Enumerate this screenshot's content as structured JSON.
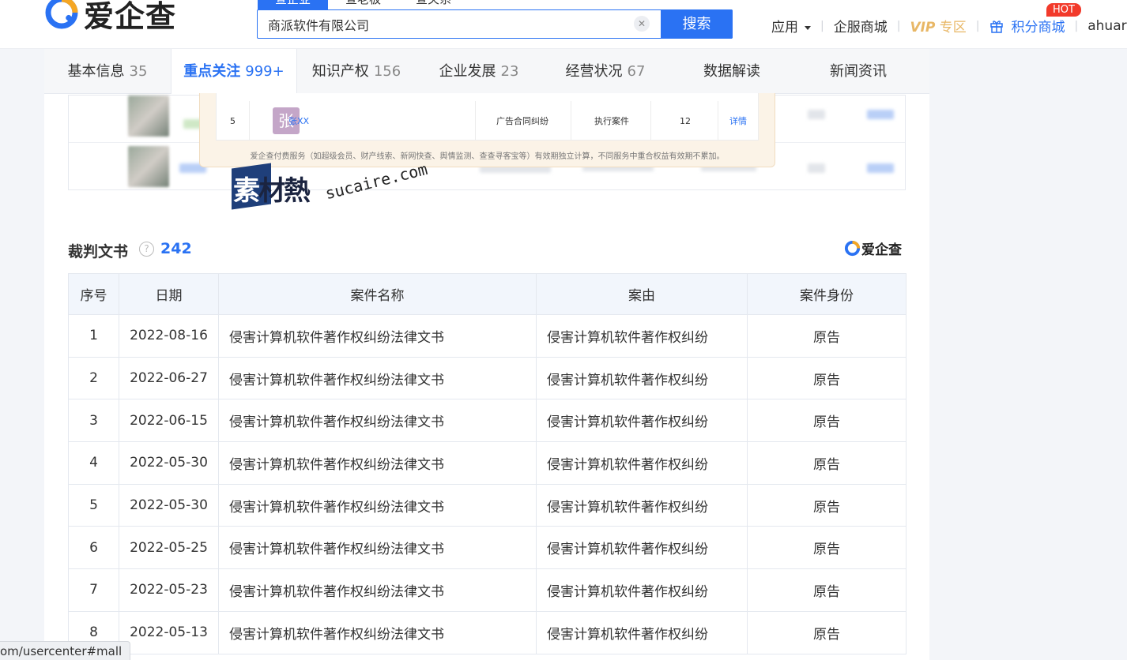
{
  "header": {
    "logo_text": "爱企查",
    "search_tabs": [
      "查企业",
      "查老板",
      "查关系"
    ],
    "search_value": "商派软件有限公司",
    "search_button": "搜索",
    "nav": {
      "apps": "应用",
      "enterprise_mall": "企服商城",
      "vip": "VIP",
      "vip_zone": "专区",
      "points_mall": "积分商城",
      "hot_badge": "HOT",
      "user": "ahuar"
    }
  },
  "tabs": [
    {
      "label": "基本信息",
      "count": "35"
    },
    {
      "label": "重点关注",
      "count": "999+"
    },
    {
      "label": "知识产权",
      "count": "156"
    },
    {
      "label": "企业发展",
      "count": "23"
    },
    {
      "label": "经营状况",
      "count": "67"
    },
    {
      "label": "数据解读",
      "count": ""
    },
    {
      "label": "新闻资讯",
      "count": ""
    }
  ],
  "popup": {
    "row_index": "5",
    "avatar_char": "张",
    "name": "张XX",
    "cause": "广告合同纠纷",
    "type": "执行案件",
    "count": "12",
    "detail": "详情",
    "note": "爱企查付费服务（如超级会员、财产线索、新网快查、舆情监测、查查寻客宝等）有效期独立计算，不同服务中重合权益有效期不累加。"
  },
  "watermark": {
    "zh_first": "素",
    "zh_rest": "材熱",
    "en": "sucaire.com"
  },
  "section": {
    "title": "裁判文书",
    "count": "242",
    "brand": "爱企查"
  },
  "table": {
    "headers": [
      "序号",
      "日期",
      "案件名称",
      "案由",
      "案件身份"
    ],
    "rows": [
      {
        "no": "1",
        "date": "2022-08-16",
        "name": "侵害计算机软件著作权纠纷法律文书",
        "cause": "侵害计算机软件著作权纠纷",
        "role": "原告"
      },
      {
        "no": "2",
        "date": "2022-06-27",
        "name": "侵害计算机软件著作权纠纷法律文书",
        "cause": "侵害计算机软件著作权纠纷",
        "role": "原告"
      },
      {
        "no": "3",
        "date": "2022-06-15",
        "name": "侵害计算机软件著作权纠纷法律文书",
        "cause": "侵害计算机软件著作权纠纷",
        "role": "原告"
      },
      {
        "no": "4",
        "date": "2022-05-30",
        "name": "侵害计算机软件著作权纠纷法律文书",
        "cause": "侵害计算机软件著作权纠纷",
        "role": "原告"
      },
      {
        "no": "5",
        "date": "2022-05-30",
        "name": "侵害计算机软件著作权纠纷法律文书",
        "cause": "侵害计算机软件著作权纠纷",
        "role": "原告"
      },
      {
        "no": "6",
        "date": "2022-05-25",
        "name": "侵害计算机软件著作权纠纷法律文书",
        "cause": "侵害计算机软件著作权纠纷",
        "role": "原告"
      },
      {
        "no": "7",
        "date": "2022-05-23",
        "name": "侵害计算机软件著作权纠纷法律文书",
        "cause": "侵害计算机软件著作权纠纷",
        "role": "原告"
      },
      {
        "no": "8",
        "date": "2022-05-13",
        "name": "侵害计算机软件著作权纠纷法律文书",
        "cause": "侵害计算机软件著作权纠纷",
        "role": "原告"
      }
    ]
  },
  "statusbar": "om/usercenter#mall",
  "colors": {
    "accent": "#2a72f3",
    "hot": "#f23a2b",
    "vip": "#e8b766"
  }
}
